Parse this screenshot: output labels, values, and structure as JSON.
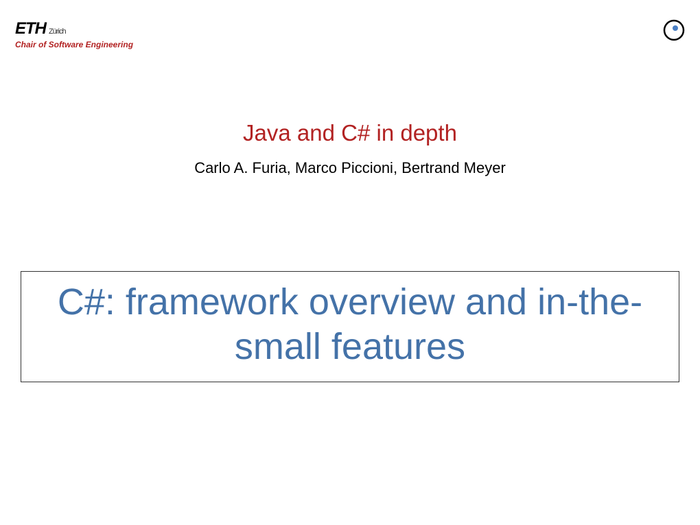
{
  "header": {
    "logo_main": "ETH",
    "logo_sub": "Zürich",
    "chair": "Chair of Software Engineering"
  },
  "course_title": "Java and C# in depth",
  "authors": "Carlo A. Furia, Marco Piccioni, Bertrand Meyer",
  "lecture_title": "C#: framework overview and in-the-small features"
}
